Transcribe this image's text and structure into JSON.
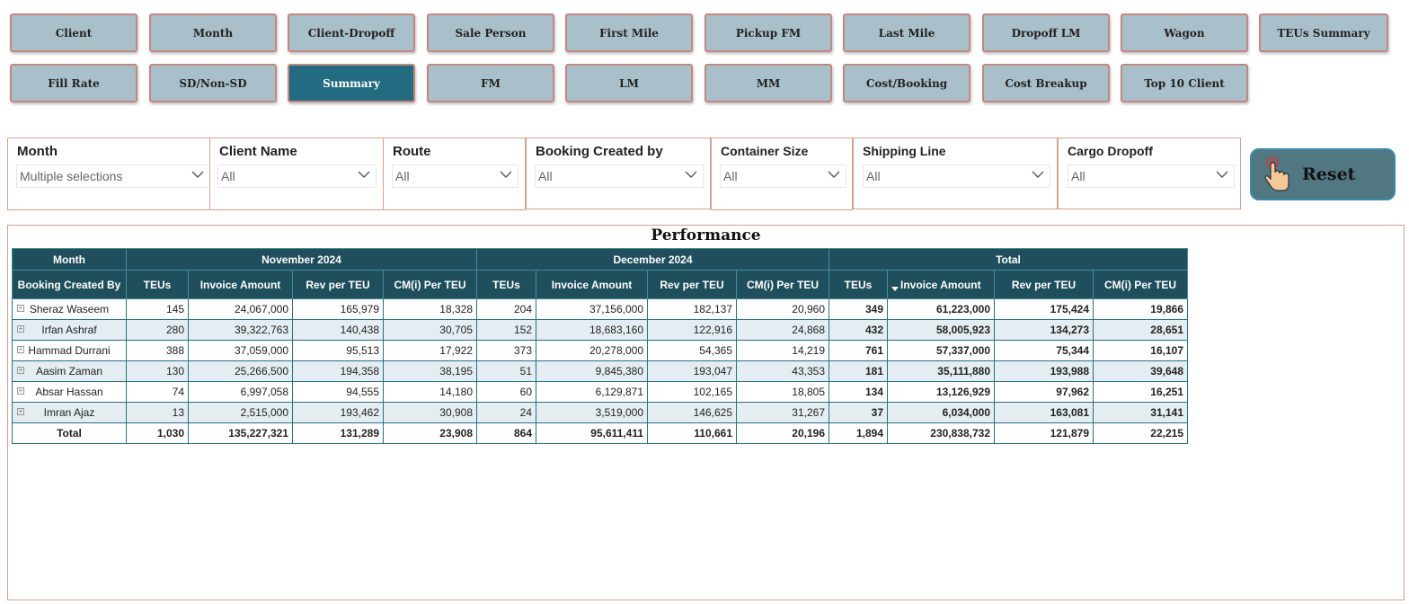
{
  "nav": {
    "row1": [
      "Client",
      "Month",
      "Client-Dropoff",
      "Sale Person",
      "First Mile",
      "Pickup FM",
      "Last Mile",
      "Dropoff LM",
      "Wagon",
      "TEUs Summary"
    ],
    "row2": [
      "Fill Rate",
      "SD/Non-SD",
      "Summary",
      "FM",
      "LM",
      "MM",
      "Cost/Booking",
      "Cost Breakup",
      "Top 10 Client"
    ],
    "active": "Summary"
  },
  "filters": {
    "month": {
      "label": "Month",
      "value": "Multiple selections"
    },
    "client_name": {
      "label": "Client Name",
      "value": "All"
    },
    "route": {
      "label": "Route",
      "value": "All"
    },
    "booking_created_by": {
      "label": "Booking Created by",
      "value": "All"
    },
    "container_size": {
      "label": "Container Size",
      "value": "All"
    },
    "shipping_line": {
      "label": "Shipping Line",
      "value": "All"
    },
    "cargo_dropoff": {
      "label": "Cargo Dropoff",
      "value": "All"
    }
  },
  "reset": {
    "label": "Reset"
  },
  "performance": {
    "title": "Performance",
    "corner_top": "Month",
    "corner_bottom": "Booking Created By",
    "groups": [
      "November 2024",
      "December 2024",
      "Total"
    ],
    "columns": [
      "TEUs",
      "Invoice Amount",
      "Rev per TEU",
      "CM(i) Per TEU"
    ],
    "rows": [
      {
        "name": "Sheraz Waseem",
        "values": [
          "145",
          "24,067,000",
          "165,979",
          "18,328",
          "204",
          "37,156,000",
          "182,137",
          "20,960",
          "349",
          "61,223,000",
          "175,424",
          "19,866"
        ]
      },
      {
        "name": "Irfan Ashraf",
        "values": [
          "280",
          "39,322,763",
          "140,438",
          "30,705",
          "152",
          "18,683,160",
          "122,916",
          "24,868",
          "432",
          "58,005,923",
          "134,273",
          "28,651"
        ]
      },
      {
        "name": "Hammad Durrani",
        "values": [
          "388",
          "37,059,000",
          "95,513",
          "17,922",
          "373",
          "20,278,000",
          "54,365",
          "14,219",
          "761",
          "57,337,000",
          "75,344",
          "16,107"
        ]
      },
      {
        "name": "Aasim Zaman",
        "values": [
          "130",
          "25,266,500",
          "194,358",
          "38,195",
          "51",
          "9,845,380",
          "193,047",
          "43,353",
          "181",
          "35,111,880",
          "193,988",
          "39,648"
        ]
      },
      {
        "name": "Absar Hassan",
        "values": [
          "74",
          "6,997,058",
          "94,555",
          "14,180",
          "60",
          "6,129,871",
          "102,165",
          "18,805",
          "134",
          "13,126,929",
          "97,962",
          "16,251"
        ]
      },
      {
        "name": "Imran Ajaz",
        "values": [
          "13",
          "2,515,000",
          "193,462",
          "30,908",
          "24",
          "3,519,000",
          "146,625",
          "31,267",
          "37",
          "6,034,000",
          "163,081",
          "31,141"
        ]
      }
    ],
    "total": {
      "name": "Total",
      "values": [
        "1,030",
        "135,227,321",
        "131,289",
        "23,908",
        "864",
        "95,611,411",
        "110,661",
        "20,196",
        "1,894",
        "230,838,732",
        "121,879",
        "22,215"
      ]
    }
  }
}
